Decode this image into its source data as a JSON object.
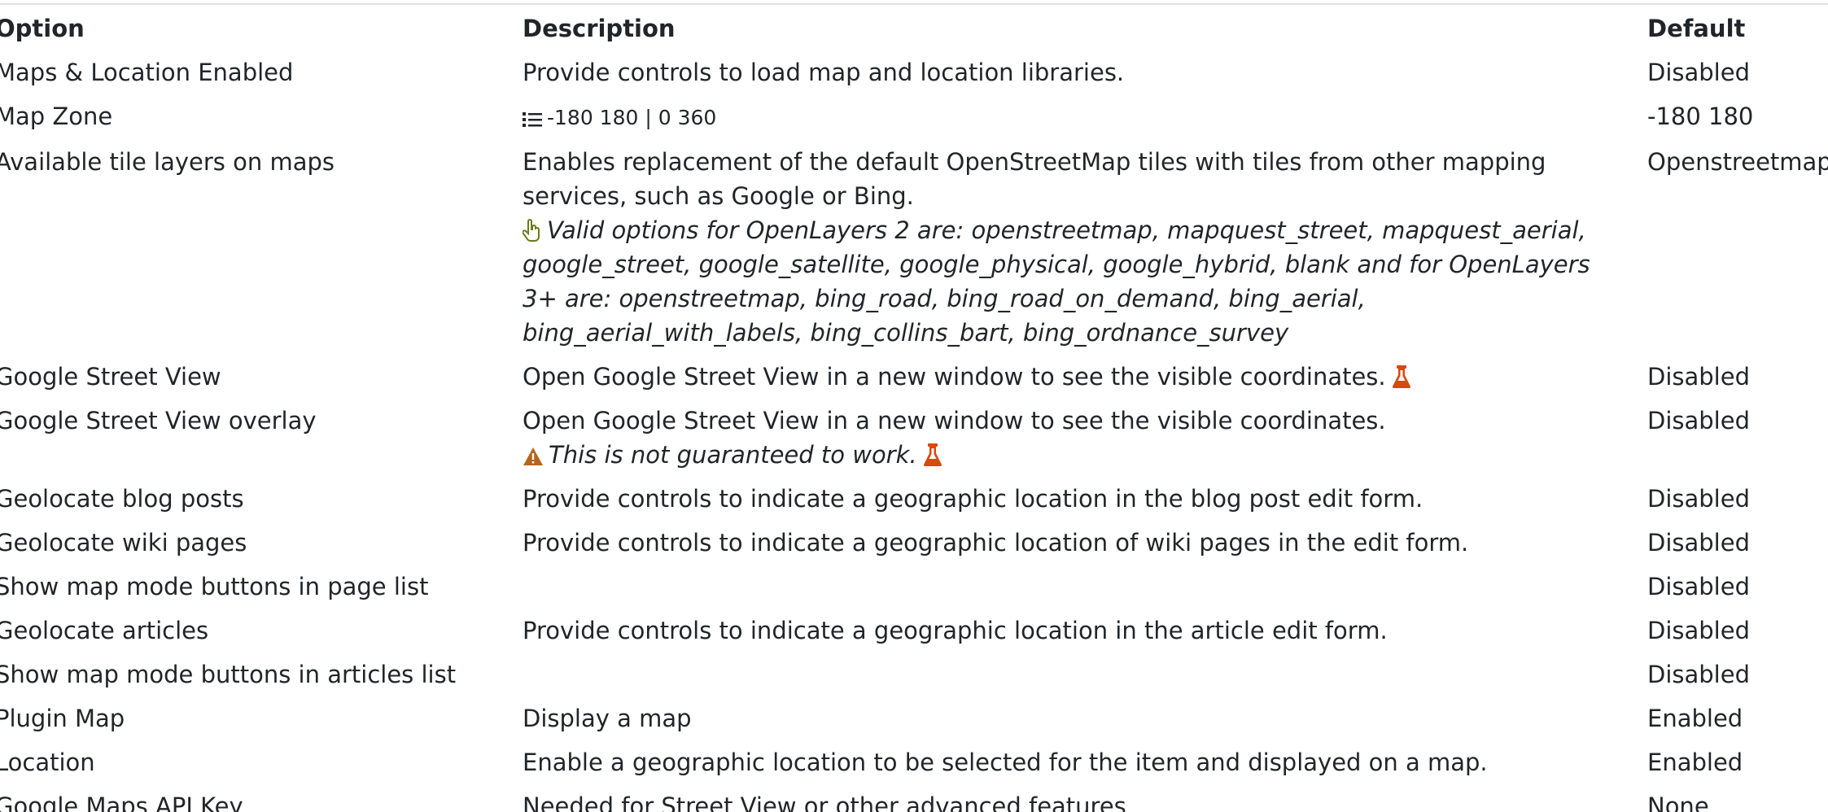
{
  "headers": {
    "option": "Option",
    "description": "Description",
    "default": "Default"
  },
  "rows": [
    {
      "option": "Maps & Location Enabled",
      "description": "Provide controls to load map and location libraries.",
      "default": "Disabled"
    },
    {
      "option": "Map Zone",
      "description": "-180 180 | 0 360",
      "default": "-180 180"
    },
    {
      "option": "Available tile layers on maps",
      "description": "Enables replacement of the default OpenStreetMap tiles with tiles from other mapping services, such as Google or Bing.",
      "note": "Valid options for OpenLayers 2 are: openstreetmap, mapquest_street, mapquest_aerial, google_street, google_satellite, google_physical, google_hybrid, blank and for OpenLayers 3+ are: openstreetmap, bing_road, bing_road_on_demand, bing_aerial, bing_aerial_with_labels, bing_collins_bart, bing_ordnance_survey",
      "default": "Openstreetmap"
    },
    {
      "option": "Google Street View",
      "description": "Open Google Street View in a new window to see the visible coordinates.",
      "default": "Disabled"
    },
    {
      "option": "Google Street View overlay",
      "description": "Open Google Street View in a new window to see the visible coordinates.",
      "note": "This is not guaranteed to work.",
      "default": "Disabled"
    },
    {
      "option": "Geolocate blog posts",
      "description": "Provide controls to indicate a geographic location in the blog post edit form.",
      "default": "Disabled"
    },
    {
      "option": "Geolocate wiki pages",
      "description": "Provide controls to indicate a geographic location of wiki pages in the edit form.",
      "default": "Disabled"
    },
    {
      "option": "Show map mode buttons in page list",
      "description": "",
      "default": "Disabled"
    },
    {
      "option": "Geolocate articles",
      "description": "Provide controls to indicate a geographic location in the article edit form.",
      "default": "Disabled"
    },
    {
      "option": "Show map mode buttons in articles list",
      "description": "",
      "default": "Disabled"
    },
    {
      "option": "Plugin Map",
      "description": "Display a map",
      "default": "Enabled"
    },
    {
      "option": "Location",
      "description": "Enable a geographic location to be selected for the item and displayed on a map.",
      "default": "Enabled"
    },
    {
      "option": "Google Maps API Key",
      "description": "Needed for Street View or other advanced features",
      "default": "None"
    }
  ],
  "icons": {
    "list": "list-icon",
    "pointer": "hand-pointer-icon",
    "warning": "warning-icon",
    "flask": "flask-icon"
  },
  "colors": {
    "flask": "#d9480f",
    "warning": "#b5651d",
    "pointer": "#6b7a1a"
  }
}
